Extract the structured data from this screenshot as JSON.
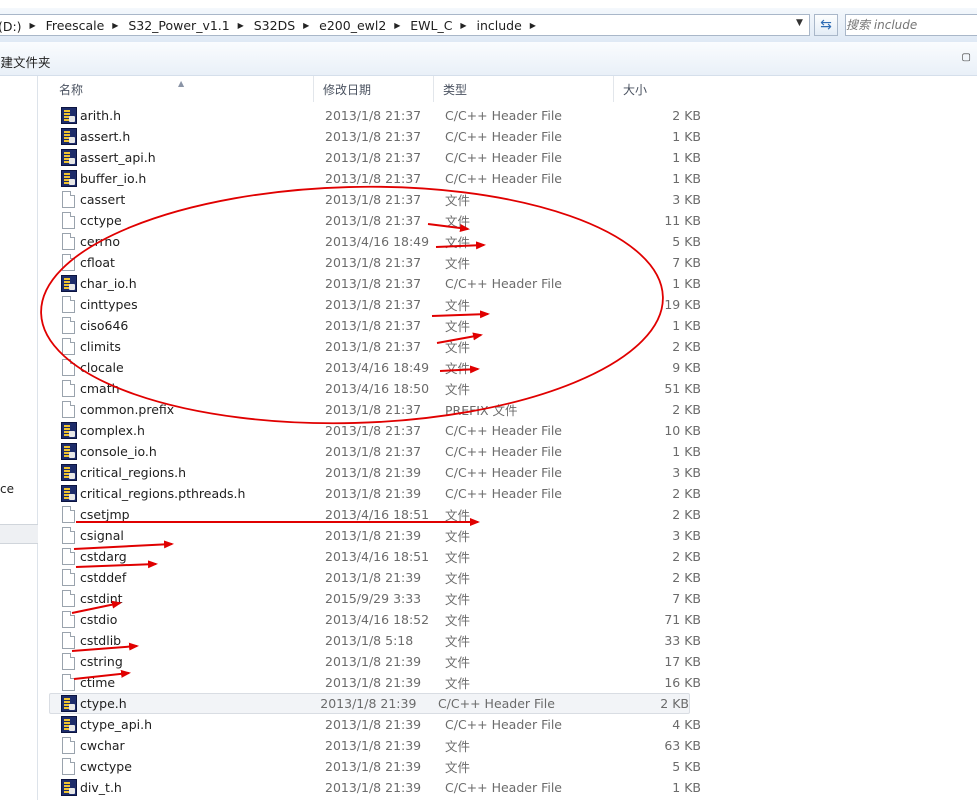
{
  "address": {
    "crumbs": [
      "本地磁盘 (D:)",
      "Freescale",
      "S32_Power_v1.1",
      "S32DS",
      "e200_ewl2",
      "EWL_C",
      "include"
    ],
    "search_placeholder": "搜索 include"
  },
  "toolbar": {
    "new_folder": "新建文件夹"
  },
  "nav": {
    "partial_label": "ce"
  },
  "columns": {
    "name": "名称",
    "date": "修改日期",
    "type": "类型",
    "size": "大小"
  },
  "accent_colors": {
    "selection": "#f2f4f7",
    "annotation": "#e00000"
  },
  "files": [
    {
      "name": "arith.h",
      "date": "2013/1/8 21:37",
      "type": "C/C++ Header File",
      "size": "2 KB",
      "icon": "header-file-icon"
    },
    {
      "name": "assert.h",
      "date": "2013/1/8 21:37",
      "type": "C/C++ Header File",
      "size": "1 KB",
      "icon": "header-file-icon"
    },
    {
      "name": "assert_api.h",
      "date": "2013/1/8 21:37",
      "type": "C/C++ Header File",
      "size": "1 KB",
      "icon": "header-file-icon"
    },
    {
      "name": "buffer_io.h",
      "date": "2013/1/8 21:37",
      "type": "C/C++ Header File",
      "size": "1 KB",
      "icon": "header-file-icon"
    },
    {
      "name": "cassert",
      "date": "2013/1/8 21:37",
      "type": "文件",
      "size": "3 KB",
      "icon": "file-icon"
    },
    {
      "name": "cctype",
      "date": "2013/1/8 21:37",
      "type": "文件",
      "size": "11 KB",
      "icon": "file-icon"
    },
    {
      "name": "cerrno",
      "date": "2013/4/16 18:49",
      "type": "文件",
      "size": "5 KB",
      "icon": "file-icon"
    },
    {
      "name": "cfloat",
      "date": "2013/1/8 21:37",
      "type": "文件",
      "size": "7 KB",
      "icon": "file-icon"
    },
    {
      "name": "char_io.h",
      "date": "2013/1/8 21:37",
      "type": "C/C++ Header File",
      "size": "1 KB",
      "icon": "header-file-icon"
    },
    {
      "name": "cinttypes",
      "date": "2013/1/8 21:37",
      "type": "文件",
      "size": "19 KB",
      "icon": "file-icon"
    },
    {
      "name": "ciso646",
      "date": "2013/1/8 21:37",
      "type": "文件",
      "size": "1 KB",
      "icon": "file-icon"
    },
    {
      "name": "climits",
      "date": "2013/1/8 21:37",
      "type": "文件",
      "size": "2 KB",
      "icon": "file-icon"
    },
    {
      "name": "clocale",
      "date": "2013/4/16 18:49",
      "type": "文件",
      "size": "9 KB",
      "icon": "file-icon"
    },
    {
      "name": "cmath",
      "date": "2013/4/16 18:50",
      "type": "文件",
      "size": "51 KB",
      "icon": "file-icon"
    },
    {
      "name": "common.prefix",
      "date": "2013/1/8 21:37",
      "type": "PREFIX 文件",
      "size": "2 KB",
      "icon": "file-icon"
    },
    {
      "name": "complex.h",
      "date": "2013/1/8 21:37",
      "type": "C/C++ Header File",
      "size": "10 KB",
      "icon": "header-file-icon"
    },
    {
      "name": "console_io.h",
      "date": "2013/1/8 21:37",
      "type": "C/C++ Header File",
      "size": "1 KB",
      "icon": "header-file-icon"
    },
    {
      "name": "critical_regions.h",
      "date": "2013/1/8 21:39",
      "type": "C/C++ Header File",
      "size": "3 KB",
      "icon": "header-file-icon"
    },
    {
      "name": "critical_regions.pthreads.h",
      "date": "2013/1/8 21:39",
      "type": "C/C++ Header File",
      "size": "2 KB",
      "icon": "header-file-icon"
    },
    {
      "name": "csetjmp",
      "date": "2013/4/16 18:51",
      "type": "文件",
      "size": "2 KB",
      "icon": "file-icon"
    },
    {
      "name": "csignal",
      "date": "2013/1/8 21:39",
      "type": "文件",
      "size": "3 KB",
      "icon": "file-icon"
    },
    {
      "name": "cstdarg",
      "date": "2013/4/16 18:51",
      "type": "文件",
      "size": "2 KB",
      "icon": "file-icon"
    },
    {
      "name": "cstddef",
      "date": "2013/1/8 21:39",
      "type": "文件",
      "size": "2 KB",
      "icon": "file-icon"
    },
    {
      "name": "cstdint",
      "date": "2015/9/29 3:33",
      "type": "文件",
      "size": "7 KB",
      "icon": "file-icon"
    },
    {
      "name": "cstdio",
      "date": "2013/4/16 18:52",
      "type": "文件",
      "size": "71 KB",
      "icon": "file-icon"
    },
    {
      "name": "cstdlib",
      "date": "2013/1/8 5:18",
      "type": "文件",
      "size": "33 KB",
      "icon": "file-icon"
    },
    {
      "name": "cstring",
      "date": "2013/1/8 21:39",
      "type": "文件",
      "size": "17 KB",
      "icon": "file-icon"
    },
    {
      "name": "ctime",
      "date": "2013/1/8 21:39",
      "type": "文件",
      "size": "16 KB",
      "icon": "file-icon"
    },
    {
      "name": "ctype.h",
      "date": "2013/1/8 21:39",
      "type": "C/C++ Header File",
      "size": "2 KB",
      "icon": "header-file-icon",
      "highlighted": true
    },
    {
      "name": "ctype_api.h",
      "date": "2013/1/8 21:39",
      "type": "C/C++ Header File",
      "size": "4 KB",
      "icon": "header-file-icon"
    },
    {
      "name": "cwchar",
      "date": "2013/1/8 21:39",
      "type": "文件",
      "size": "63 KB",
      "icon": "file-icon"
    },
    {
      "name": "cwctype",
      "date": "2013/1/8 21:39",
      "type": "文件",
      "size": "5 KB",
      "icon": "file-icon"
    },
    {
      "name": "div_t.h",
      "date": "2013/1/8 21:39",
      "type": "C/C++ Header File",
      "size": "1 KB",
      "icon": "header-file-icon"
    }
  ]
}
